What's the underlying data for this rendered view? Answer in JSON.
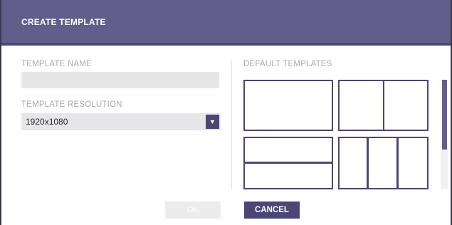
{
  "dialog": {
    "title": "CREATE TEMPLATE",
    "template_name_label": "TEMPLATE NAME",
    "template_name_value": "",
    "template_resolution_label": "TEMPLATE RESOLUTION",
    "resolution_selected": "1920x1080",
    "dropdown_arrow_icon": "caret-down-icon",
    "default_templates_label": "DEFAULT TEMPLATES",
    "templates": [
      {
        "name": "single-pane"
      },
      {
        "name": "two-columns"
      },
      {
        "name": "two-rows"
      },
      {
        "name": "three-columns"
      }
    ],
    "ok_label": "OK",
    "cancel_label": "CANCEL"
  },
  "colors": {
    "header": "#625d8a",
    "accent": "#4b4774",
    "muted_label": "#a9a9b2",
    "input_bg": "#e6e6e8"
  }
}
